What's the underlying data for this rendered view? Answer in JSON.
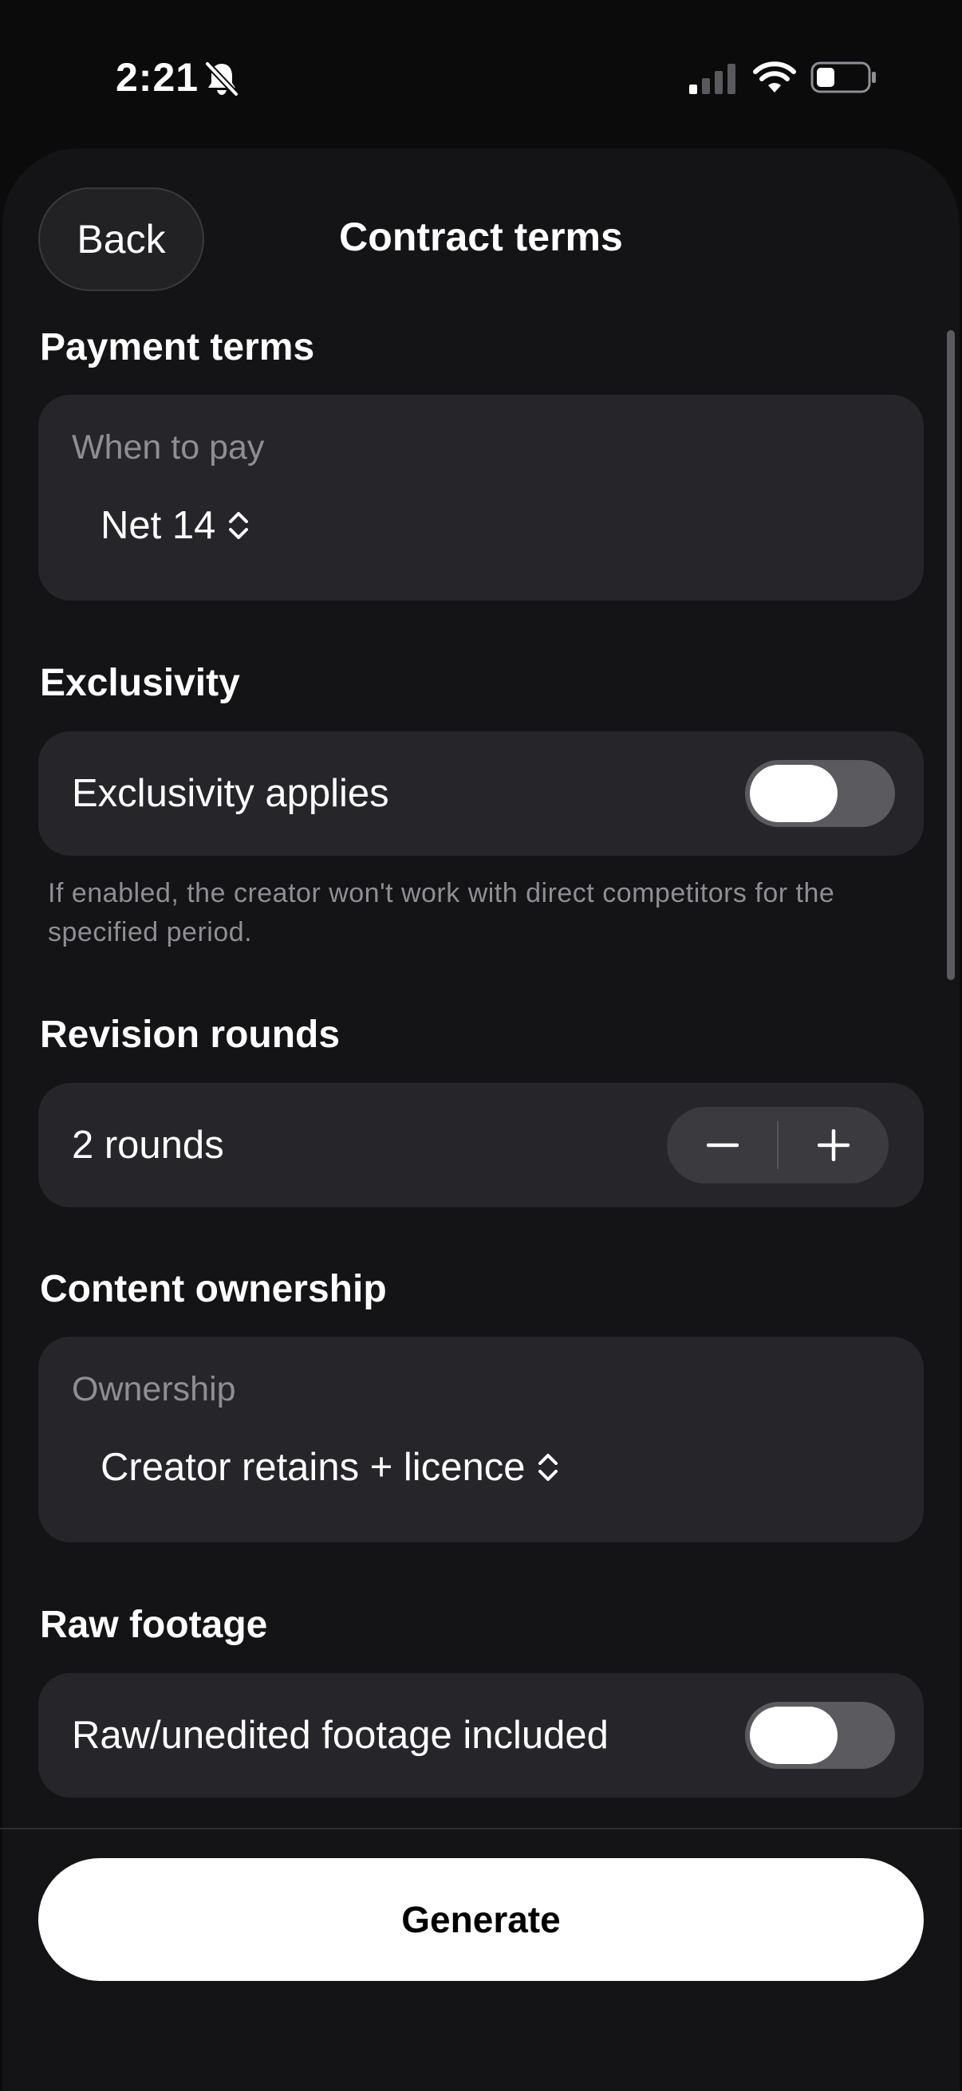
{
  "status_bar": {
    "time": "2:21"
  },
  "header": {
    "back_label": "Back",
    "title": "Contract terms"
  },
  "payment_terms": {
    "section_title": "Payment terms",
    "field_label": "When to pay",
    "selected_value": "Net 14"
  },
  "exclusivity": {
    "section_title": "Exclusivity",
    "row_label": "Exclusivity applies",
    "enabled": false,
    "footnote": "If enabled, the creator won't work with direct competitors for the specified period."
  },
  "revision_rounds": {
    "section_title": "Revision rounds",
    "value_label": "2 rounds"
  },
  "content_ownership": {
    "section_title": "Content ownership",
    "field_label": "Ownership",
    "selected_value": "Creator retains + licence"
  },
  "raw_footage": {
    "section_title": "Raw footage",
    "row_label": "Raw/unedited footage included",
    "enabled": false
  },
  "footer": {
    "generate_label": "Generate"
  },
  "colors": {
    "background": "#0b0b0c",
    "sheet": "#141416",
    "card": "#26262a",
    "secondary_text": "#8e8e93",
    "toggle_track_off": "#5a5a5f",
    "primary_button": "#ffffff"
  }
}
